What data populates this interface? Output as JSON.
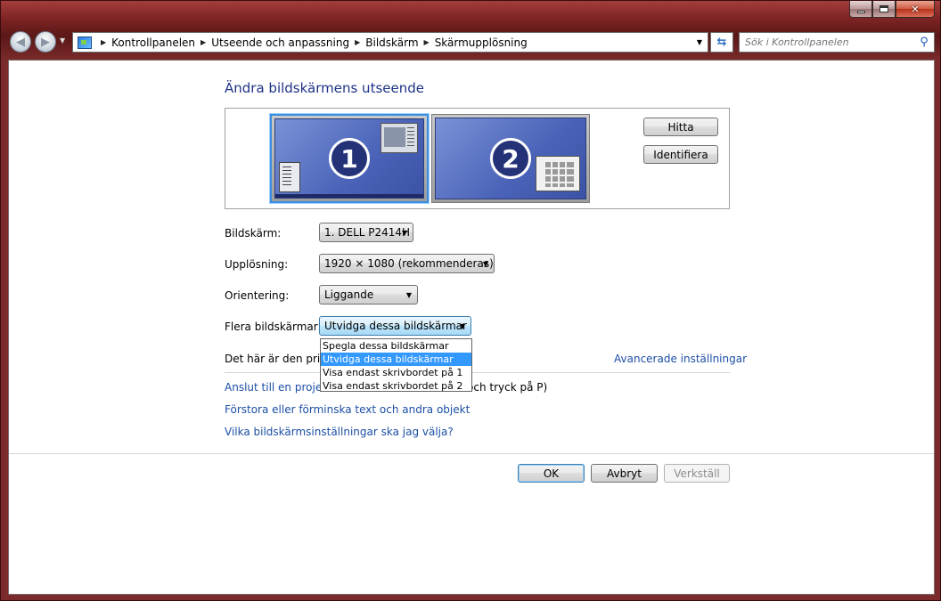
{
  "window": {
    "caption": {
      "minimize": "–",
      "maximize": "□",
      "close": "✕"
    }
  },
  "nav": {
    "breadcrumbs": [
      "Kontrollpanelen",
      "Utseende och anpassning",
      "Bildskärm",
      "Skärmupplösning"
    ],
    "search_placeholder": "Sök i Kontrollpanelen"
  },
  "main": {
    "title": "Ändra bildskärmens utseende",
    "monitors": [
      {
        "number": "1",
        "selected": true
      },
      {
        "number": "2",
        "selected": false
      }
    ],
    "detect_button": "Hitta",
    "identify_button": "Identifiera",
    "display_label": "Bildskärm:",
    "display_value": "1. DELL P2414H",
    "resolution_label": "Upplösning:",
    "resolution_value": "1920 × 1080 (rekommenderas)",
    "orientation_label": "Orientering:",
    "orientation_value": "Liggande",
    "multiple_label": "Flera bildskärmar:",
    "multiple_value": "Utvidga dessa bildskärmar",
    "multiple_options": [
      "Spegla dessa bildskärmar",
      "Utvidga dessa bildskärmar",
      "Visa endast skrivbordet på 1",
      "Visa endast skrivbordet på 2"
    ],
    "primary_text": "Det här är den primä",
    "advanced_link": "Avancerade inställningar",
    "projector_link": "Anslut till en projekt",
    "projector_rest": "och tryck på P)",
    "text_size_link": "Förstora eller förminska text och andra objekt",
    "which_settings_link": "Vilka bildskärmsinställningar ska jag välja?",
    "ok_button": "OK",
    "cancel_button": "Avbryt",
    "apply_button": "Verkställ"
  }
}
